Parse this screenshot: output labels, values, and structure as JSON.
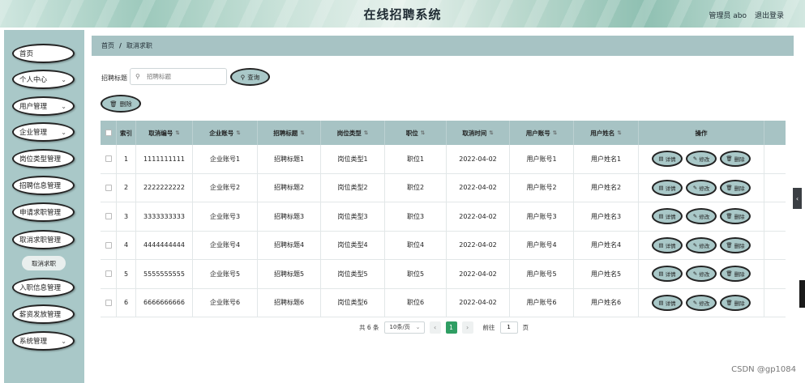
{
  "header": {
    "title": "在线招聘系统",
    "user": "管理员 abo",
    "logout": "退出登录"
  },
  "sidebar": {
    "items": [
      {
        "label": "首页",
        "chevron": false
      },
      {
        "label": "个人中心",
        "chevron": true
      },
      {
        "label": "用户管理",
        "chevron": true
      },
      {
        "label": "企业管理",
        "chevron": true
      },
      {
        "label": "岗位类型管理",
        "chevron": false
      },
      {
        "label": "招聘信息管理",
        "chevron": false
      },
      {
        "label": "申请求职管理",
        "chevron": false
      },
      {
        "label": "取消求职管理",
        "chevron": false
      },
      {
        "label": "入职信息管理",
        "chevron": false
      },
      {
        "label": "薪资发放管理",
        "chevron": false
      },
      {
        "label": "系统管理",
        "chevron": true
      }
    ],
    "submenu": "取消求职",
    "chevron_icon": "chevron-down-icon"
  },
  "breadcrumb": {
    "home": "首页",
    "separator": "/",
    "current": "取消求职"
  },
  "search": {
    "label": "招聘标题",
    "placeholder": "招聘标题",
    "query_label": "查询",
    "delete_label": "删除"
  },
  "table": {
    "headers": [
      "索引",
      "取消编号",
      "企业账号",
      "招聘标题",
      "岗位类型",
      "职位",
      "取消时间",
      "用户账号",
      "用户姓名",
      "操作"
    ],
    "rows": [
      [
        "1",
        "1111111111",
        "企业账号1",
        "招聘标题1",
        "岗位类型1",
        "职位1",
        "2022-04-02",
        "用户账号1",
        "用户姓名1"
      ],
      [
        "2",
        "2222222222",
        "企业账号2",
        "招聘标题2",
        "岗位类型2",
        "职位2",
        "2022-04-02",
        "用户账号2",
        "用户姓名2"
      ],
      [
        "3",
        "3333333333",
        "企业账号3",
        "招聘标题3",
        "岗位类型3",
        "职位3",
        "2022-04-02",
        "用户账号3",
        "用户姓名3"
      ],
      [
        "4",
        "4444444444",
        "企业账号4",
        "招聘标题4",
        "岗位类型4",
        "职位4",
        "2022-04-02",
        "用户账号4",
        "用户姓名4"
      ],
      [
        "5",
        "5555555555",
        "企业账号5",
        "招聘标题5",
        "岗位类型5",
        "职位5",
        "2022-04-02",
        "用户账号5",
        "用户姓名5"
      ],
      [
        "6",
        "6666666666",
        "企业账号6",
        "招聘标题6",
        "岗位类型6",
        "职位6",
        "2022-04-02",
        "用户账号6",
        "用户姓名6"
      ]
    ],
    "actions": {
      "detail": "详情",
      "edit": "修改",
      "delete": "删除"
    }
  },
  "pagination": {
    "total": "共 6 条",
    "page_size": "10条/页",
    "current_page": "1",
    "goto_label": "前往",
    "goto_value": "1",
    "page_suffix": "页"
  },
  "watermark": "CSDN @gp1084",
  "colors": {
    "accent": "#a9c8c8",
    "header_row": "#a7c3c4",
    "active_page": "#2f9e63"
  }
}
